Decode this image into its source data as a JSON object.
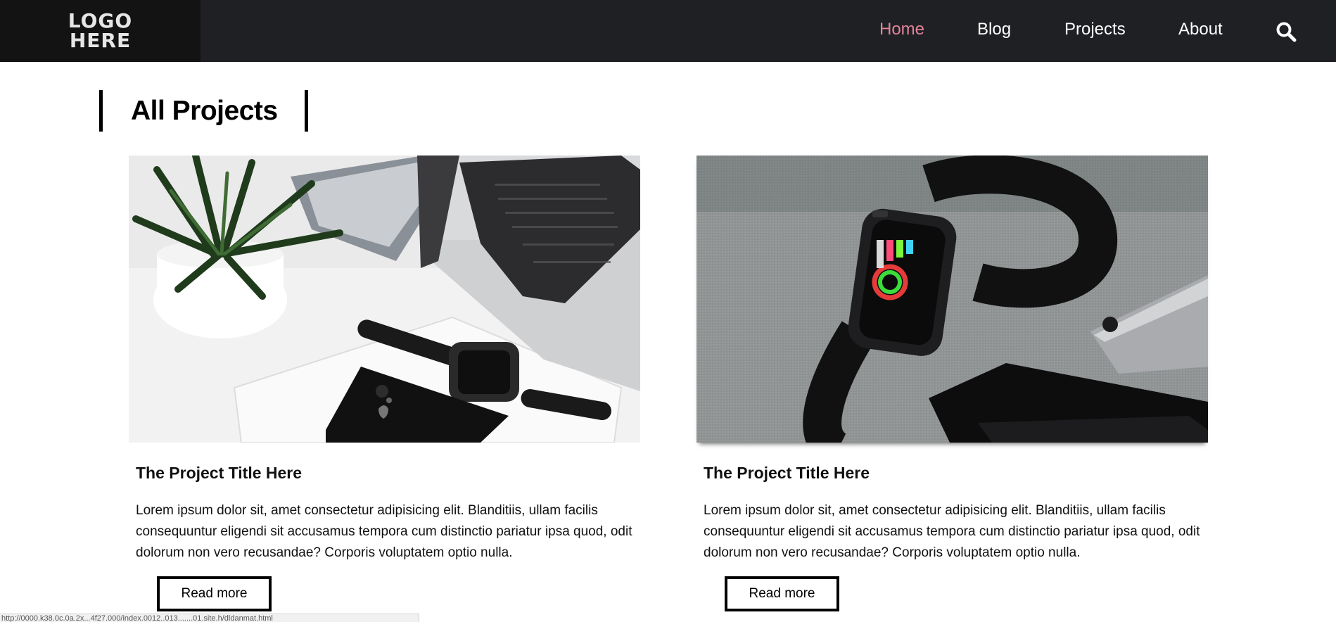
{
  "header": {
    "logo": {
      "line1": "LOGO",
      "line2": "HERE"
    },
    "nav": [
      {
        "label": "Home",
        "active": true
      },
      {
        "label": "Blog",
        "active": false
      },
      {
        "label": "Projects",
        "active": false
      },
      {
        "label": "About",
        "active": false
      }
    ],
    "search_icon": "search-icon",
    "accent_color": "#e3849a"
  },
  "main": {
    "title": "All Projects",
    "projects": [
      {
        "image": "desk-laptop-watch-phone-photo",
        "title": "The Project Title Here",
        "text": "Lorem ipsum dolor sit, amet consectetur adipisicing elit. Blanditiis, ullam facilis consequuntur eligendi sit accusamus tempora cum distinctio pariatur ipsa quod, odit dolorum non vero recusandae? Corporis voluptatem optio nulla.",
        "button": "Read more"
      },
      {
        "image": "smartwatch-on-fabric-photo",
        "title": "The Project Title Here",
        "text": "Lorem ipsum dolor sit, amet consectetur adipisicing elit. Blanditiis, ullam facilis consequuntur eligendi sit accusamus tempora cum distinctio pariatur ipsa quod, odit dolorum non vero recusandae? Corporis voluptatem optio nulla.",
        "button": "Read more"
      }
    ]
  },
  "status_bar": {
    "text": "http://0000.k38.0c.0a.2x...4f27.000/index.0012..013.......01.site.h/dldanmat.html"
  }
}
